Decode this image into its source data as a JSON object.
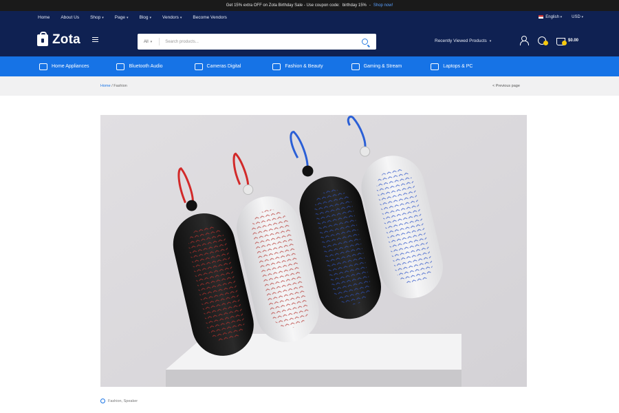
{
  "announcement": {
    "text": "Get 15% extra OFF on Zota Birthday Sale - Use coupon code: ",
    "code": "birthday 15%",
    "link": "Shop now!"
  },
  "topnav": {
    "items": [
      "Home",
      "About Us",
      "Shop",
      "Page",
      "Blog",
      "Vendors",
      "Become Vendors"
    ]
  },
  "locale": {
    "language": "English",
    "currency": "USD"
  },
  "logo": {
    "text": "Zota"
  },
  "search": {
    "category": "All",
    "placeholder": "Search products..."
  },
  "recent_label": "Recently Viewed Products",
  "cart": {
    "total": "$0.00"
  },
  "categories": [
    {
      "label": "Home Appliances",
      "icon": "appliance-icon"
    },
    {
      "label": "Bluetooth Audio",
      "icon": "speaker-icon"
    },
    {
      "label": "Cameras Digital",
      "icon": "camera-icon"
    },
    {
      "label": "Fashion & Beauty",
      "icon": "shirt-icon"
    },
    {
      "label": "Gaming & Stream",
      "icon": "gamepad-icon"
    },
    {
      "label": "Laptops & PC",
      "icon": "laptop-icon"
    }
  ],
  "breadcrumb": {
    "home": "Home",
    "separator": " / ",
    "current": "Fashion"
  },
  "prev_page": "< Previous page",
  "post_meta": "Fashion, Speaker",
  "colors": {
    "header_bg": "#0f2152",
    "category_bar": "#1673e6",
    "accent_yellow": "#f6c90e",
    "announce_bg": "#1a1a1a"
  }
}
